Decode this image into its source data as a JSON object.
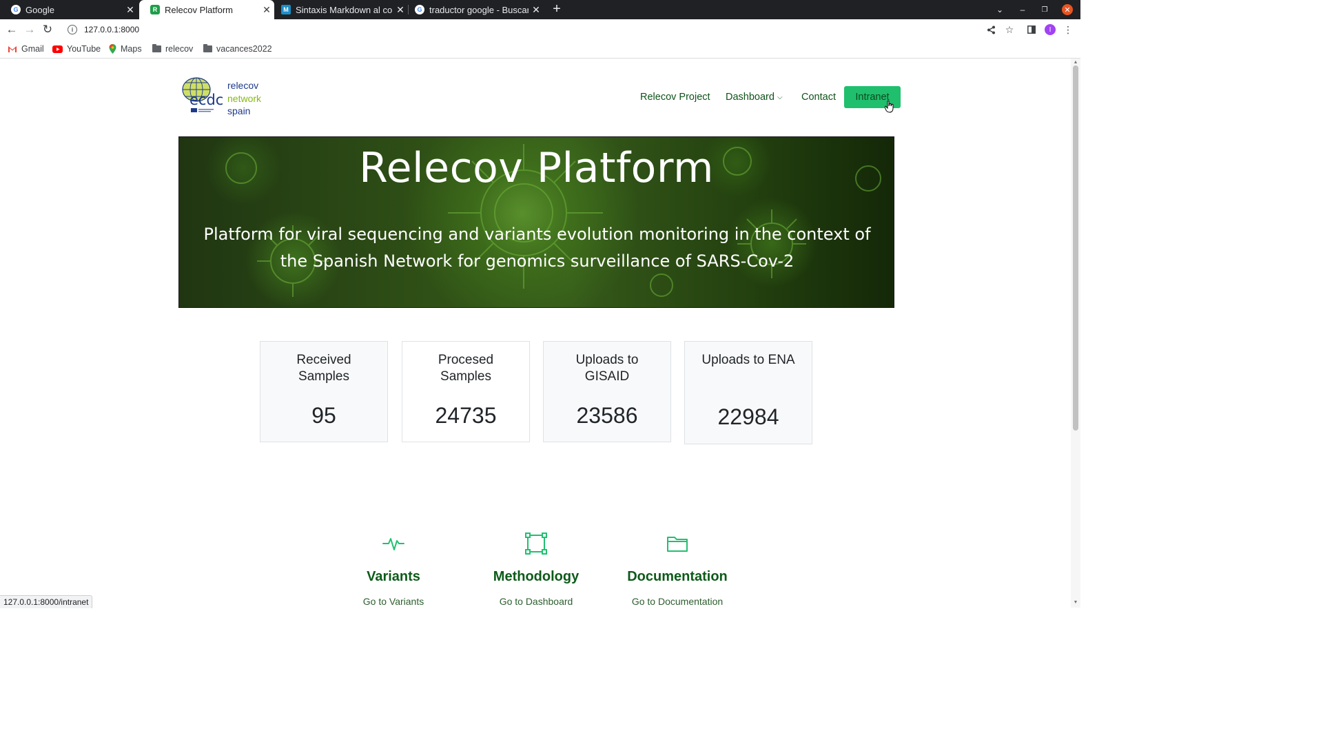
{
  "browser": {
    "tabs": [
      {
        "title": "Google",
        "favicon": "google-favicon",
        "active": false
      },
      {
        "title": "Relecov Platform",
        "favicon": "relecov-favicon",
        "active": true
      },
      {
        "title": "Sintaxis Markdown al com",
        "favicon": "markdown-favicon",
        "active": false
      },
      {
        "title": "traductor google - Buscar",
        "favicon": "google-favicon",
        "active": false
      }
    ],
    "url": "127.0.0.1:8000",
    "bookmarks": [
      {
        "label": "Gmail",
        "icon": "gmail-icon"
      },
      {
        "label": "YouTube",
        "icon": "youtube-icon"
      },
      {
        "label": "Maps",
        "icon": "maps-icon"
      },
      {
        "label": "relecov",
        "icon": "folder-icon"
      },
      {
        "label": "vacances2022",
        "icon": "folder-icon"
      }
    ],
    "profile_initial": "I",
    "status_url": "127.0.0.1:8000/intranet"
  },
  "site": {
    "logo": {
      "mark": "ecdc",
      "line1": "relecov",
      "line2": "network",
      "line3": "spain"
    },
    "nav": {
      "project": "Relecov Project",
      "dashboard": "Dashboard",
      "contact": "Contact",
      "intranet": "Intranet"
    },
    "hero": {
      "title": "Relecov Platform",
      "subtitle": "Platform for viral sequencing and variants evolution monitoring in the context of the Spanish Network for genomics surveillance of SARS-Cov-2"
    },
    "stats": [
      {
        "label": "Received Samples",
        "value": "95"
      },
      {
        "label": "Procesed Samples",
        "value": "24735"
      },
      {
        "label": "Uploads to GISAID",
        "value": "23586"
      },
      {
        "label": "Uploads to ENA",
        "value": "22984"
      }
    ],
    "features": [
      {
        "title": "Variants",
        "link": "Go to Variants",
        "icon": "activity-icon"
      },
      {
        "title": "Methodology",
        "link": "Go to Dashboard",
        "icon": "bounding-box-icon"
      },
      {
        "title": "Documentation",
        "link": "Go to Documentation",
        "icon": "folder-icon"
      }
    ]
  },
  "colors": {
    "accent_green": "#1fbf6d",
    "nav_text": "#0f5219",
    "feature_icon": "#20c070"
  }
}
